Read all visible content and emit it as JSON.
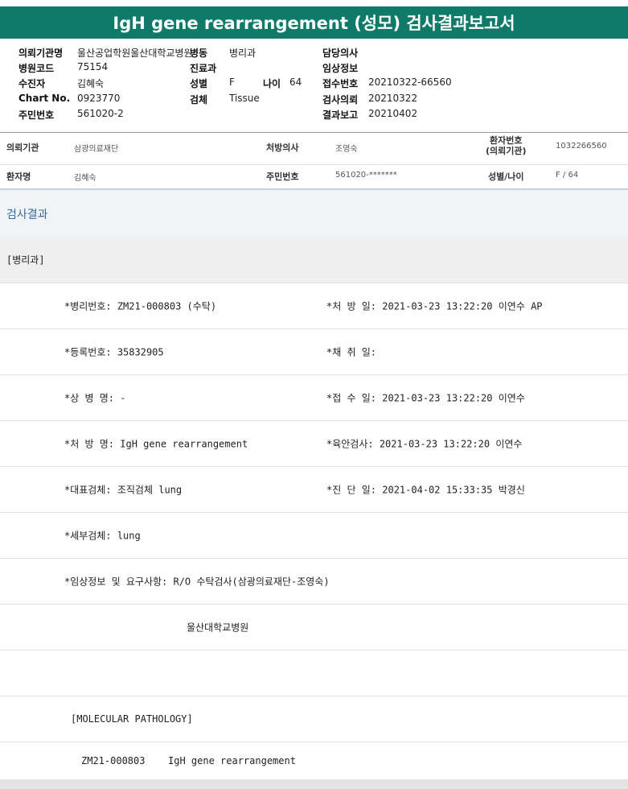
{
  "report": {
    "title": "IgH gene rearrangement (성모) 검사결과보고서",
    "left_col": [
      {
        "label": "의뢰기관명",
        "value": "울산공업학원울산대학교병원"
      },
      {
        "label": "병원코드",
        "value": "75154"
      },
      {
        "label": "수진자",
        "value": "김혜숙"
      },
      {
        "label": "Chart No.",
        "value": "0923770"
      },
      {
        "label": "주민번호",
        "value": "561020-2"
      }
    ],
    "mid_col": [
      {
        "label": "병동",
        "value": "병리과"
      },
      {
        "label": "진료과",
        "value": ""
      },
      {
        "label": "성별",
        "value": "F"
      },
      {
        "label": "검체",
        "value": "Tissue"
      }
    ],
    "age": {
      "label": "나이",
      "value": "64"
    },
    "right_col": [
      {
        "label": "담당의사",
        "value": ""
      },
      {
        "label": "임상정보",
        "value": ""
      },
      {
        "label": "접수번호",
        "value": "20210322-66560"
      },
      {
        "label": "검사의뢰",
        "value": "20210322"
      },
      {
        "label": "결과보고",
        "value": "20210402"
      }
    ]
  },
  "patient": {
    "row1": [
      {
        "label": "의뢰기관",
        "value": "삼광의료재단"
      },
      {
        "label": "처방의사",
        "value": "조영숙"
      },
      {
        "label": "환자번호\n(의뢰기관)",
        "value": "1032266560"
      }
    ],
    "row2": [
      {
        "label": "환자명",
        "value": "김혜숙"
      },
      {
        "label": "주민번호",
        "value": "561020-*******"
      },
      {
        "label": "성별/나이",
        "value": "F / 64"
      }
    ]
  },
  "results": {
    "section_title": "검사결과",
    "department": "[병리과]",
    "rows": [
      {
        "left": "*병리번호: ZM21-000803 (수탁)",
        "right": "*처 방 일: 2021-03-23 13:22:20  이연수 AP"
      },
      {
        "left": "*등록번호: 35832905",
        "right": "*채 취 일:"
      },
      {
        "left": "*상 병 명: -",
        "right": "*접 수 일: 2021-03-23 13:22:20  이연수"
      },
      {
        "left": "*처 방 명: IgH gene rearrangement",
        "right": "*육안검사: 2021-03-23 13:22:20  이연수"
      },
      {
        "left": "*대표검체: 조직검체 lung",
        "right": "*진 단 일: 2021-04-02 15:33:35  박경신"
      },
      {
        "left": "*세부검체: lung",
        "right": ""
      },
      {
        "left": "*임상정보 및 요구사항: R/O 수탁검사(삼광의료재단-조영숙)",
        "right": ""
      }
    ],
    "hospital": "울산대학교병원",
    "blank": "",
    "molecular": "[MOLECULAR PATHOLOGY]",
    "specimen_no": "ZM21-000803",
    "specimen_test": "IgH gene rearrangement"
  }
}
